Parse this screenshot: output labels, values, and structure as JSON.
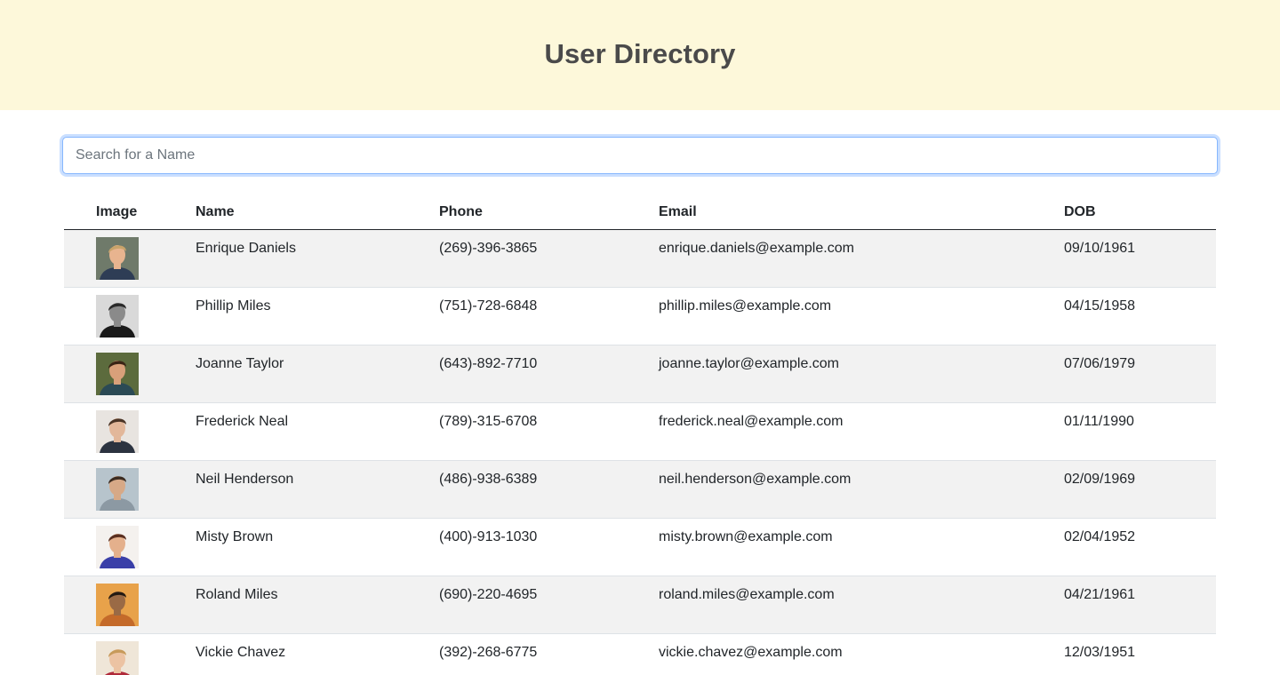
{
  "header": {
    "title": "User Directory"
  },
  "search": {
    "placeholder": "Search for a Name",
    "value": ""
  },
  "table": {
    "columns": [
      "Image",
      "Name",
      "Phone",
      "Email",
      "DOB"
    ],
    "rows": [
      {
        "name": "Enrique Daniels",
        "phone": "(269)-396-3865",
        "email": "enrique.daniels@example.com",
        "dob": "09/10/1961",
        "avatar": {
          "bg": "#6f7a6a",
          "skin": "#e8b48f",
          "hair": "#c9a36a",
          "shirt": "#2e3d55"
        }
      },
      {
        "name": "Phillip Miles",
        "phone": "(751)-728-6848",
        "email": "phillip.miles@example.com",
        "dob": "04/15/1958",
        "avatar": {
          "bg": "#d9d9d9",
          "skin": "#8a8a8a",
          "hair": "#2a2a2a",
          "shirt": "#1a1a1a"
        }
      },
      {
        "name": "Joanne Taylor",
        "phone": "(643)-892-7710",
        "email": "joanne.taylor@example.com",
        "dob": "07/06/1979",
        "avatar": {
          "bg": "#5c6b3d",
          "skin": "#d9a07a",
          "hair": "#3a2415",
          "shirt": "#2b4a55"
        }
      },
      {
        "name": "Frederick Neal",
        "phone": "(789)-315-6708",
        "email": "frederick.neal@example.com",
        "dob": "01/11/1990",
        "avatar": {
          "bg": "#e8e4e0",
          "skin": "#e2b79a",
          "hair": "#4a3426",
          "shirt": "#2c3340"
        }
      },
      {
        "name": "Neil Henderson",
        "phone": "(486)-938-6389",
        "email": "neil.henderson@example.com",
        "dob": "02/09/1969",
        "avatar": {
          "bg": "#b7c4cc",
          "skin": "#d7a987",
          "hair": "#3b2b20",
          "shirt": "#8c99a3"
        }
      },
      {
        "name": "Misty Brown",
        "phone": "(400)-913-1030",
        "email": "misty.brown@example.com",
        "dob": "02/04/1952",
        "avatar": {
          "bg": "#f4f1ee",
          "skin": "#e4b08c",
          "hair": "#5a2f20",
          "shirt": "#3a3fa8"
        }
      },
      {
        "name": "Roland Miles",
        "phone": "(690)-220-4695",
        "email": "roland.miles@example.com",
        "dob": "04/21/1961",
        "avatar": {
          "bg": "#e8a24a",
          "skin": "#9a6a45",
          "hair": "#241a12",
          "shirt": "#c46a2a"
        }
      },
      {
        "name": "Vickie Chavez",
        "phone": "(392)-268-6775",
        "email": "vickie.chavez@example.com",
        "dob": "12/03/1951",
        "avatar": {
          "bg": "#efe6d8",
          "skin": "#ecc3a3",
          "hair": "#c79a5a",
          "shirt": "#b02a3a"
        }
      }
    ]
  }
}
